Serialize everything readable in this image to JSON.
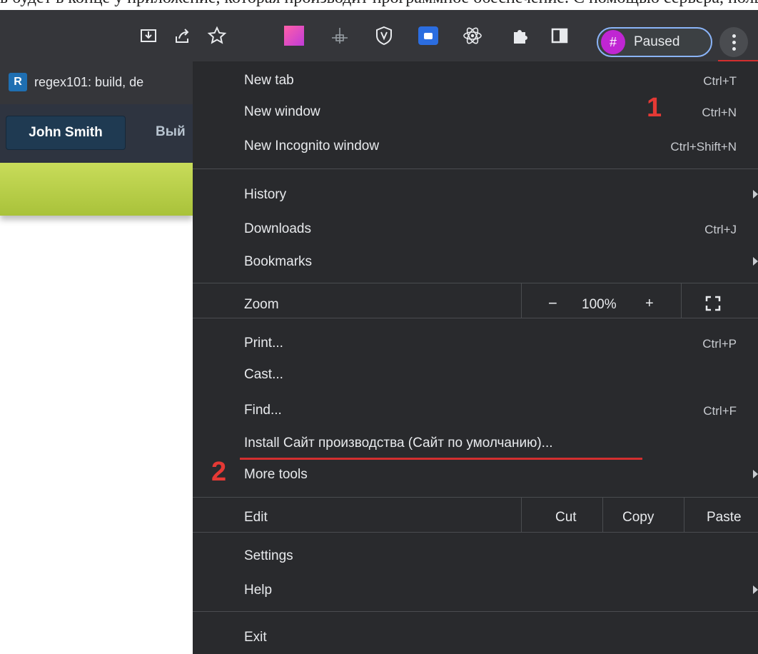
{
  "top_strip_text": "ь будет в конце у приложение, которая производит программное обеспечение. С помощью сервера, пользователи могут",
  "toolbar": {
    "icons": [
      "install-icon",
      "share-icon",
      "star-icon",
      "extension-gradient-icon",
      "extension-crosshair-icon",
      "shield-icon",
      "meet-icon",
      "react-icon",
      "puzzle-icon",
      "sidepanel-icon"
    ],
    "profile_initial": "#",
    "profile_label": "Paused"
  },
  "bookmarks": {
    "favicon": "R",
    "label": "regex101: build, de"
  },
  "page_nav": {
    "user": "John Smith",
    "logout": "Вый"
  },
  "menu": {
    "new_tab": {
      "label": "New tab",
      "shortcut": "Ctrl+T"
    },
    "new_window": {
      "label": "New window",
      "shortcut": "Ctrl+N"
    },
    "incognito": {
      "label": "New Incognito window",
      "shortcut": "Ctrl+Shift+N"
    },
    "history": {
      "label": "History"
    },
    "downloads": {
      "label": "Downloads",
      "shortcut": "Ctrl+J"
    },
    "bookmarks": {
      "label": "Bookmarks"
    },
    "zoom": {
      "label": "Zoom",
      "minus": "−",
      "value": "100%",
      "plus": "+"
    },
    "print": {
      "label": "Print...",
      "shortcut": "Ctrl+P"
    },
    "cast": {
      "label": "Cast..."
    },
    "find": {
      "label": "Find...",
      "shortcut": "Ctrl+F"
    },
    "install": {
      "label": "Install Сайт производства (Сайт по умолчанию)..."
    },
    "more_tools": {
      "label": "More tools"
    },
    "edit": {
      "label": "Edit",
      "cut": "Cut",
      "copy": "Copy",
      "paste": "Paste"
    },
    "settings": {
      "label": "Settings"
    },
    "help": {
      "label": "Help"
    },
    "exit": {
      "label": "Exit"
    }
  },
  "annotations": {
    "one": "1",
    "two": "2"
  },
  "colors": {
    "annotation": "#e53935",
    "menu_bg": "#292a2d",
    "toolbar_bg": "#35363a",
    "profile_accent": "#c026d3",
    "chip_border": "#8ab4f8"
  }
}
